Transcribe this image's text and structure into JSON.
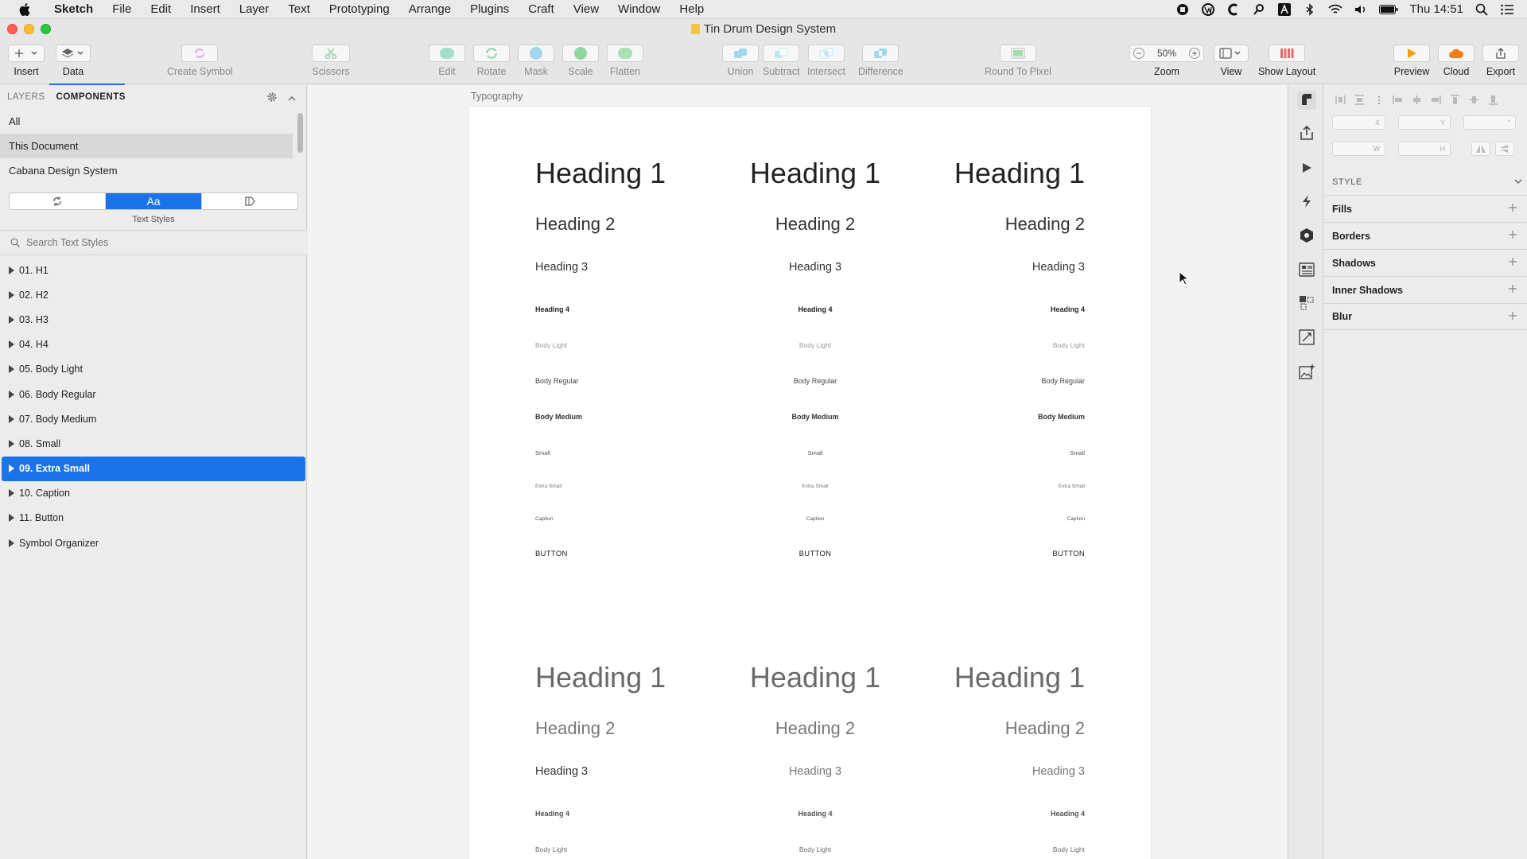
{
  "menubar": {
    "items": [
      "Sketch",
      "File",
      "Edit",
      "Insert",
      "Layer",
      "Text",
      "Prototyping",
      "Arrange",
      "Plugins",
      "Craft",
      "View",
      "Window",
      "Help"
    ],
    "clock": "Thu 14:51"
  },
  "window": {
    "title": "Tin Drum Design System"
  },
  "toolbar": {
    "insert": "Insert",
    "data": "Data",
    "create_symbol": "Create Symbol",
    "scissors": "Scissors",
    "edit": "Edit",
    "rotate": "Rotate",
    "mask": "Mask",
    "scale": "Scale",
    "flatten": "Flatten",
    "union": "Union",
    "subtract": "Subtract",
    "intersect": "Intersect",
    "difference": "Difference",
    "round_to_pixel": "Round To Pixel",
    "zoom_value": "50%",
    "zoom": "Zoom",
    "view": "View",
    "show_layout": "Show Layout",
    "preview": "Preview",
    "cloud": "Cloud",
    "export": "Export"
  },
  "left_panel": {
    "tab_layers": "LAYERS",
    "tab_components": "COMPONENTS",
    "libraries": [
      "All",
      "This Document",
      "Cabana Design System"
    ],
    "segment_text": "Aa",
    "segment_label": "Text Styles",
    "search_placeholder": "Search Text Styles",
    "styles": [
      "01. H1",
      "02. H2",
      "03. H3",
      "04. H4",
      "05. Body Light",
      "06. Body Regular",
      "07. Body Medium",
      "08. Small",
      "09. Extra Small",
      "10. Caption",
      "11. Button",
      "Symbol Organizer"
    ]
  },
  "canvas": {
    "artboard_label": "Typography",
    "samples": {
      "h1": "Heading 1",
      "h2": "Heading 2",
      "h3": "Heading 3",
      "h4": "Heading 4",
      "body_light": "Body Light",
      "body_regular": "Body Regular",
      "body_medium": "Body Medium",
      "small": "Small",
      "extra_small": "Extra Small",
      "caption": "Caption",
      "button": "BUTTON"
    }
  },
  "inspector": {
    "x": "X",
    "y": "Y",
    "rot": "°",
    "w": "W",
    "h": "H",
    "style_header": "STYLE",
    "sections": [
      "Fills",
      "Borders",
      "Shadows",
      "Inner Shadows",
      "Blur"
    ]
  },
  "colors": {
    "accent": "#1a73e8",
    "preview": "#f5a100",
    "cloud": "#f07d1a"
  }
}
